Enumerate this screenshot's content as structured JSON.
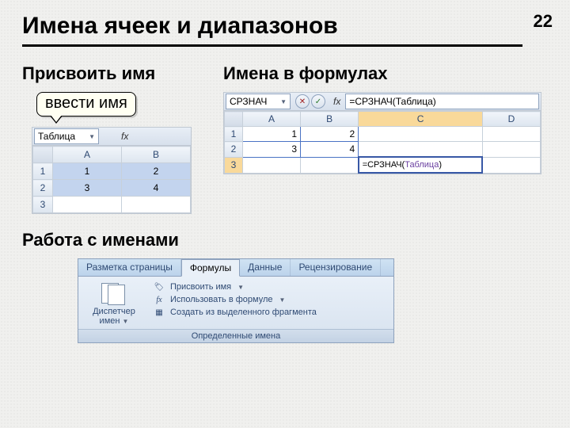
{
  "page": {
    "number": "22",
    "title": "Имена ячеек и диапазонов"
  },
  "sections": {
    "assign": "Присвоить имя",
    "formulas": "Имена в формулах",
    "work": "Работа с именами"
  },
  "callout": {
    "text": "ввести имя"
  },
  "excel1": {
    "namebox": "Таблица",
    "fx": "fx",
    "cols": [
      "A",
      "B"
    ],
    "rows": [
      "1",
      "2",
      "3"
    ],
    "data": [
      [
        "1",
        "2"
      ],
      [
        "3",
        "4"
      ]
    ]
  },
  "excel2": {
    "namebox": "СРЗНАЧ",
    "fx": "fx",
    "formula_bar": "=СРЗНАЧ(Таблица)",
    "cols": [
      "A",
      "B",
      "C",
      "D"
    ],
    "rows": [
      "1",
      "2",
      "3"
    ],
    "data": [
      [
        "1",
        "2",
        "",
        ""
      ],
      [
        "3",
        "4",
        "",
        ""
      ]
    ],
    "formula_prefix": "=СРЗНАЧ(",
    "formula_name": "Таблица",
    "formula_suffix": ")"
  },
  "ribbon": {
    "tabs": {
      "layout": "Разметка страницы",
      "formulas": "Формулы",
      "data": "Данные",
      "review": "Рецензирование"
    },
    "name_manager_l1": "Диспетчер",
    "name_manager_l2": "имен",
    "fx": "fx",
    "options": {
      "define_name": "Присвоить имя",
      "use_in_formula": "Использовать в формуле",
      "create_from_selection": "Создать из выделенного фрагмента"
    },
    "group_label": "Определенные имена"
  }
}
